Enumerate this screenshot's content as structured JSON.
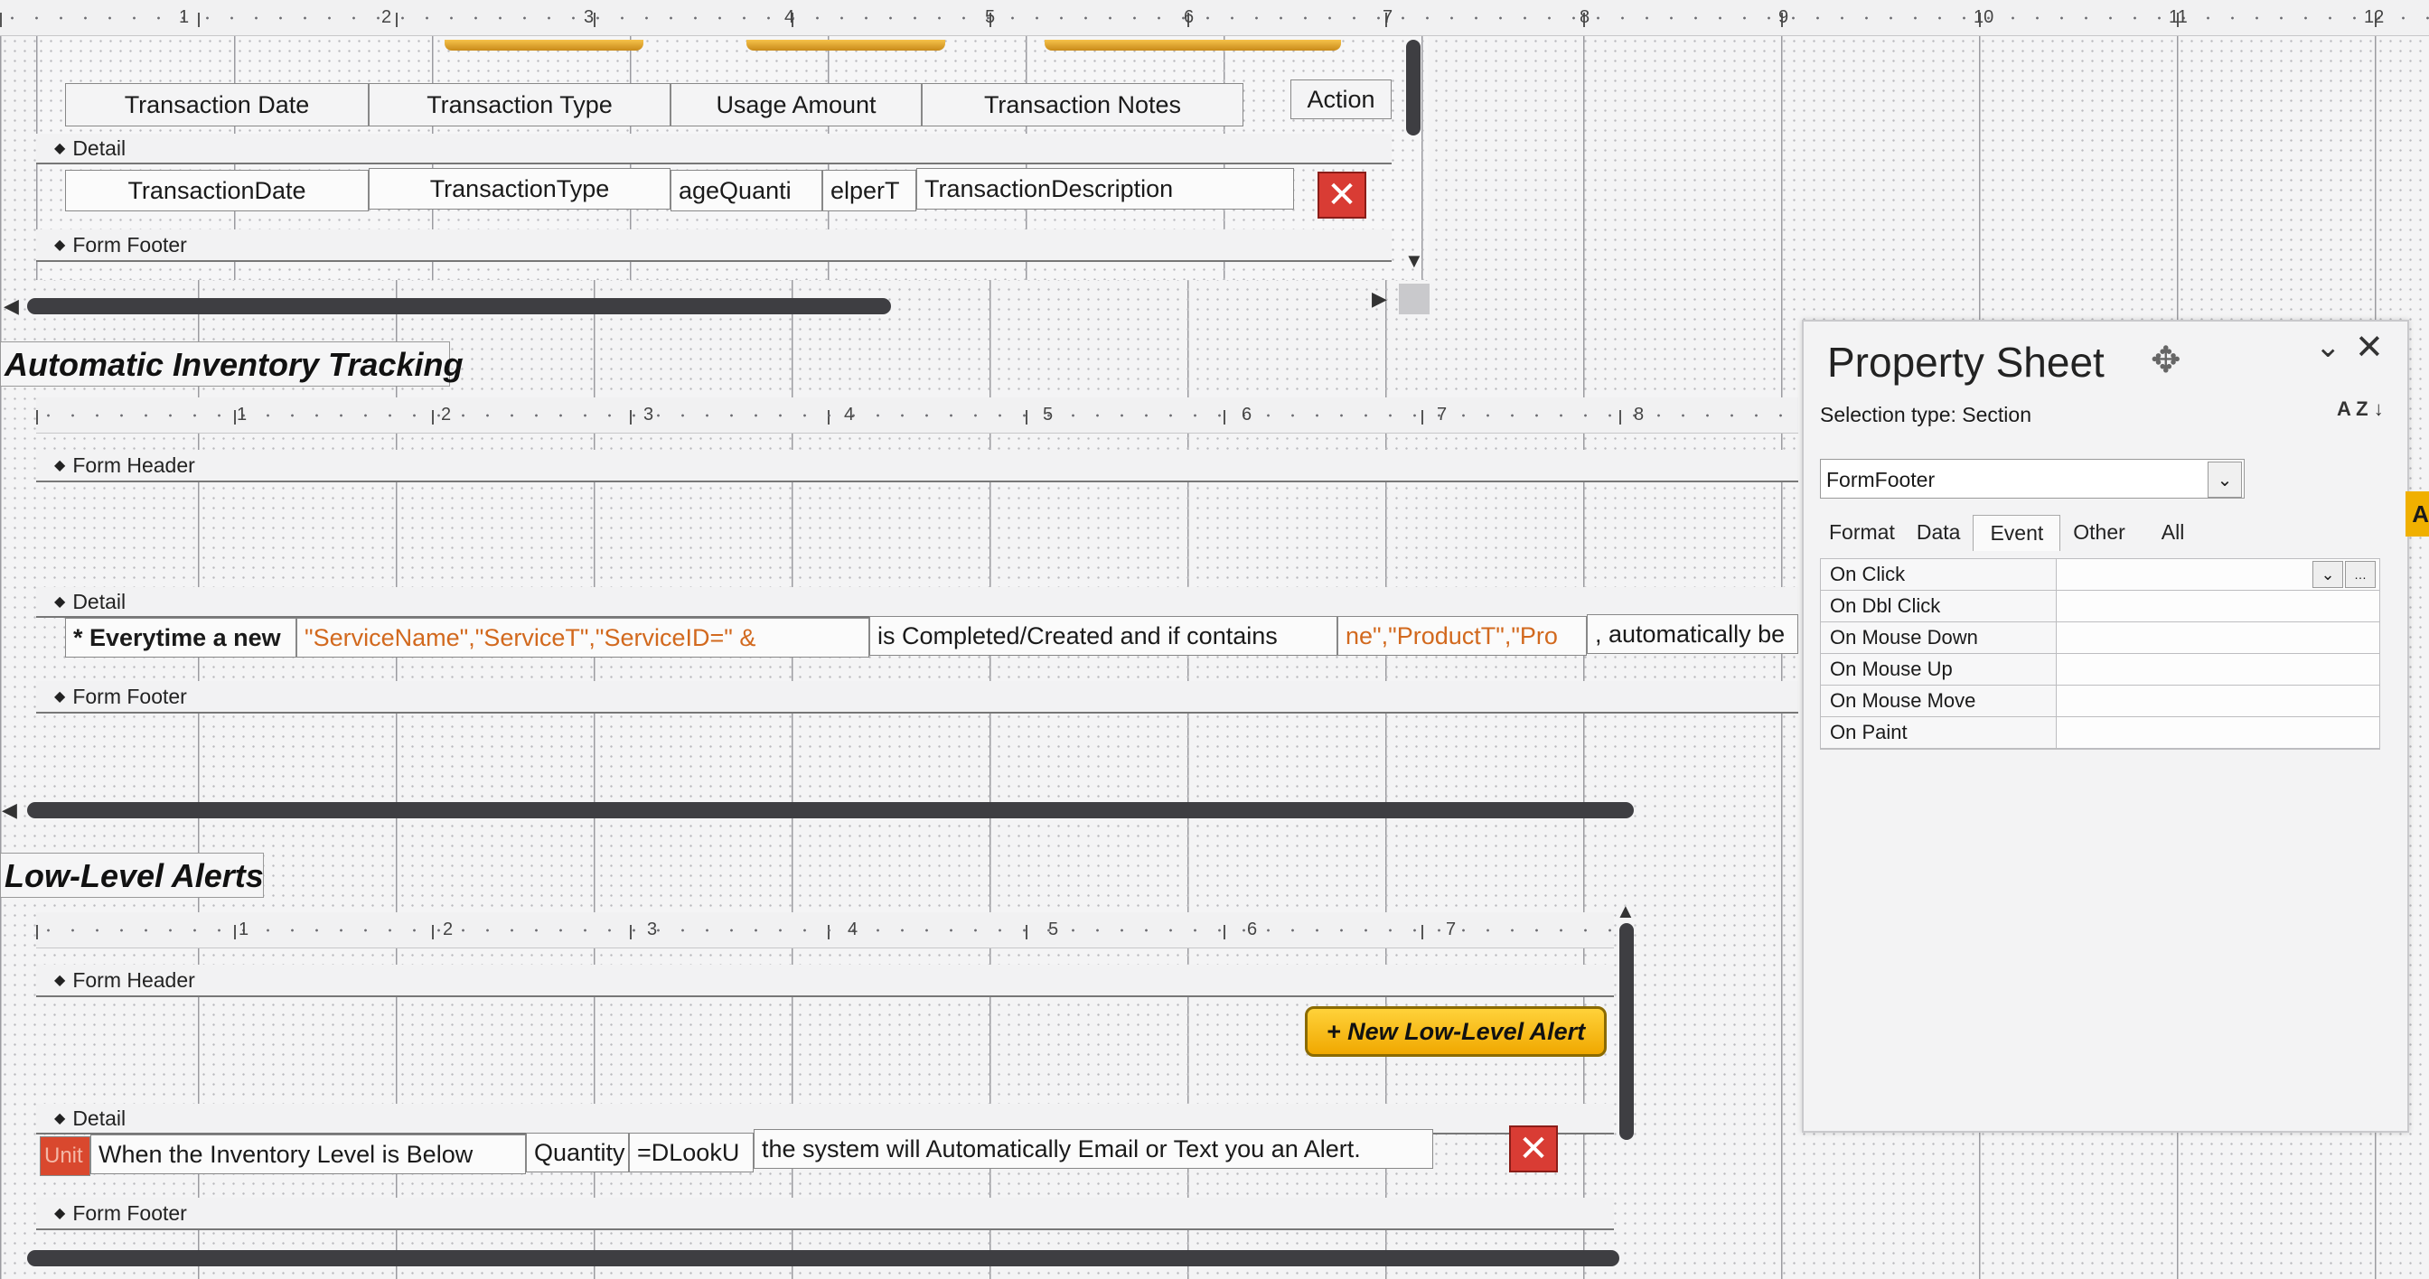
{
  "top_ruler": [
    "1",
    "2",
    "3",
    "4",
    "5",
    "6",
    "7",
    "8",
    "9",
    "10",
    "11",
    "12"
  ],
  "section1": {
    "header_cells": [
      "Transaction Date",
      "Transaction Type",
      "Usage Amount",
      "Transaction Notes",
      "Action"
    ],
    "detail_band": "Detail",
    "fields": [
      "TransactionDate",
      "TransactionType",
      "ageQuanti",
      "elperT",
      "TransactionDescription"
    ],
    "footer_band": "Form Footer"
  },
  "section2": {
    "title": "Automatic Inventory Tracking",
    "ruler": [
      "1",
      "2",
      "3",
      "4",
      "5",
      "6",
      "7",
      "8"
    ],
    "header_band": "Form Header",
    "detail_band": "Detail",
    "fields": [
      {
        "text": "* Everytime a new",
        "color": "black"
      },
      {
        "text": "\"ServiceName\",\"ServiceT\",\"ServiceID=\" &",
        "color": "orange"
      },
      {
        "text": "is Completed/Created and if contains",
        "color": "black"
      },
      {
        "text": "ne\",\"ProductT\",\"Pro",
        "color": "orange"
      },
      {
        "text": ", automatically be",
        "color": "black"
      }
    ],
    "footer_band": "Form Footer"
  },
  "section3": {
    "title": "Low-Level Alerts",
    "ruler": [
      "1",
      "2",
      "3",
      "4",
      "5",
      "6",
      "7"
    ],
    "header_band": "Form Header",
    "new_button": "+ New Low-Level Alert",
    "detail_band": "Detail",
    "unit_label": "Unit",
    "fields": [
      "When the Inventory Level is Below",
      "Quantity",
      "=DLookU",
      "the system will Automatically Email or Text you an Alert."
    ],
    "footer_band": "Form Footer"
  },
  "property_sheet": {
    "title": "Property Sheet",
    "selection_type_label": "Selection type:",
    "selection_type_value": "Section",
    "selected_object": "FormFooter",
    "tabs": [
      "Format",
      "Data",
      "Event",
      "Other",
      "All"
    ],
    "active_tab": "Event",
    "properties": [
      "On Click",
      "On Dbl Click",
      "On Mouse Down",
      "On Mouse Up",
      "On Mouse Move",
      "On Paint"
    ],
    "sort_icon_label": "A Z",
    "edge_letter": "A"
  },
  "icons": [
    "move-icon",
    "chevron-down-icon",
    "close-icon",
    "sort-az-icon",
    "delete-icon",
    "section-triangle-icon"
  ]
}
